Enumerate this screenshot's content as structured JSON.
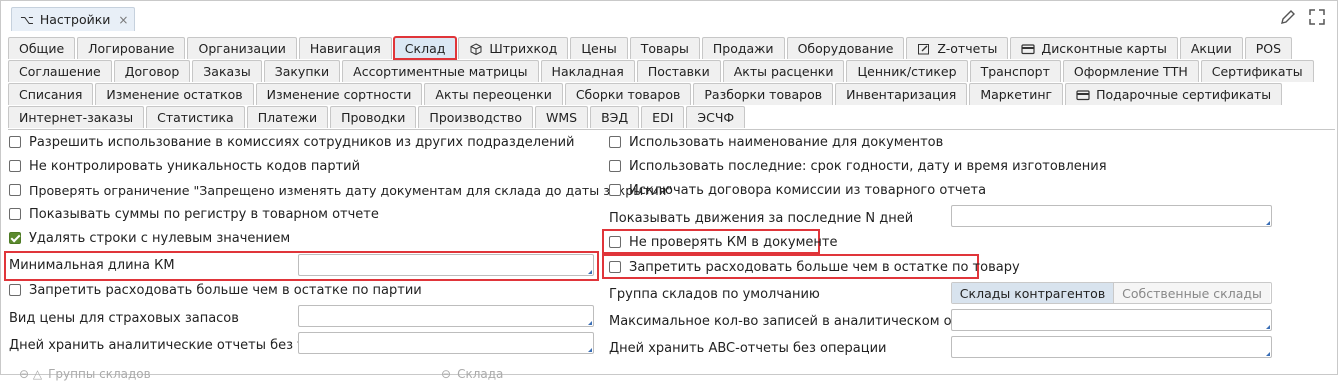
{
  "window": {
    "tab_title": "Настройки",
    "tab_glyph": "⌥",
    "close_glyph": "×"
  },
  "tabs": {
    "row1": [
      "Общие",
      "Логирование",
      "Организации",
      "Навигация",
      "Склад",
      "Штрихкод",
      "Цены",
      "Товары",
      "Продажи",
      "Оборудование",
      "Z-отчеты",
      "Дисконтные карты",
      "Акции",
      "POS"
    ],
    "row2": [
      "Соглашение",
      "Договор",
      "Заказы",
      "Закупки",
      "Ассортиментные матрицы",
      "Накладная",
      "Поставки",
      "Акты расценки",
      "Ценник/стикер",
      "Транспорт",
      "Оформление ТТН",
      "Сертификаты"
    ],
    "row3": [
      "Списания",
      "Изменение остатков",
      "Изменение сортности",
      "Акты переоценки",
      "Сборки товаров",
      "Разборки товаров",
      "Инвентаризация",
      "Маркетинг",
      "Подарочные сертификаты"
    ],
    "row4": [
      "Интернет-заказы",
      "Статистика",
      "Платежи",
      "Проводки",
      "Производство",
      "WMS",
      "ВЭД",
      "EDI",
      "ЭСЧФ"
    ],
    "active": "Склад"
  },
  "left": {
    "cb1": "Разрешить использование в комиссиях сотрудников из других подразделений",
    "cb2": "Не контролировать уникальность кодов партий",
    "cb3": "Проверять ограничение \"Запрещено изменять дату документам для склада до даты закрытия\"",
    "cb4": "Показывать суммы по регистру в товарном отчете",
    "cb5": "Удалять строки с нулевым значением",
    "min_km": "Минимальная длина КМ",
    "cb6": "Запретить расходовать больше чем в остатке по партии",
    "price_type": "Вид цены для страховых запасов",
    "keep_days": "Дней хранить аналитические отчеты без типов"
  },
  "right": {
    "cb1": "Использовать наименование для документов",
    "cb2": "Использовать последние: срок годности, дату и время изготовления",
    "cb3": "Исключать договора комиссии из товарного отчета",
    "last_n": "Показывать движения за последние N дней",
    "cb4": "Не проверять КМ в документе",
    "cb5": "Запретить расходовать больше чем в остатке по товару",
    "group": "Группа складов по умолчанию",
    "seg_on": "Склады контрагентов",
    "seg_off": "Собственные склады",
    "max_records": "Максимальное кол-во записей в аналитическом отчете",
    "abc_days": "Дней хранить ABC-отчеты без операции"
  },
  "bottom": {
    "left": "Группы складов",
    "right": "Склада"
  },
  "colors": {
    "highlight": "#e0353a",
    "accent": "#3b6fb6",
    "checked": "#5b8a2e"
  }
}
